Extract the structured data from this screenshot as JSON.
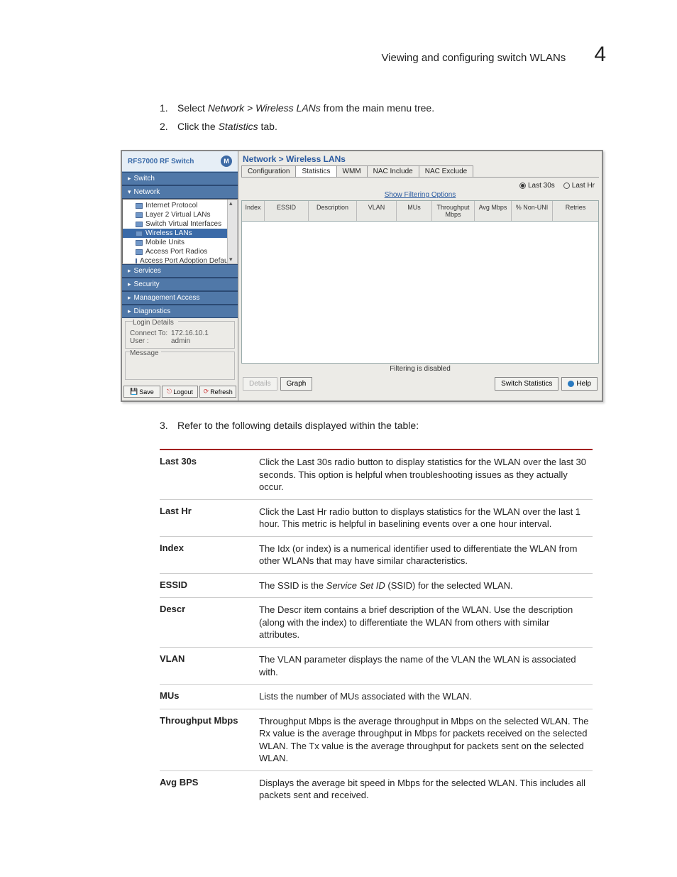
{
  "header": {
    "title": "Viewing and configuring switch WLANs",
    "chapter": "4"
  },
  "steps": {
    "s1_pre": "Select ",
    "s1_em": "Network > Wireless LANs",
    "s1_post": " from the main menu tree.",
    "s2_pre": "Click the ",
    "s2_em": "Statistics",
    "s2_post": " tab.",
    "s3": "Refer to the following details displayed within the table:"
  },
  "shot": {
    "sidebar": {
      "product_a": "RFS7000",
      "product_b": " RF Switch",
      "logo": "M",
      "acc": {
        "switch": "Switch",
        "network": "Network",
        "services": "Services",
        "security": "Security",
        "mgmt": "Management Access",
        "diag": "Diagnostics"
      },
      "tree": {
        "ip": "Internet Protocol",
        "l2": "Layer 2 Virtual LANs",
        "svi": "Switch Virtual Interfaces",
        "wlans": "Wireless LANs",
        "mu": "Mobile Units",
        "apr": "Access Port Radios",
        "apd": "Access Port Adoption Defaults"
      },
      "login": {
        "legend": "Login Details",
        "connect_l": "Connect To:",
        "connect_v": "172.16.10.1",
        "user_l": "User :",
        "user_v": "admin"
      },
      "msg_legend": "Message",
      "btns": {
        "save": "Save",
        "logout": "Logout",
        "refresh": "Refresh"
      }
    },
    "main": {
      "crumb": "Network > Wireless LANs",
      "tabs": {
        "config": "Configuration",
        "stats": "Statistics",
        "wmm": "WMM",
        "nac_in": "NAC Include",
        "nac_ex": "NAC Exclude"
      },
      "radios": {
        "last30": "Last 30s",
        "lasthr": "Last Hr"
      },
      "filter_link": "Show Filtering Options",
      "cols": {
        "index": "Index",
        "essid": "ESSID",
        "desc": "Description",
        "vlan": "VLAN",
        "mus": "MUs",
        "tput": "Throughput Mbps",
        "avg": "Avg Mbps",
        "nonuni": "% Non-UNI",
        "retries": "Retries"
      },
      "filter_status": "Filtering is disabled",
      "btns": {
        "details": "Details",
        "graph": "Graph",
        "switch_stats": "Switch Statistics",
        "help": "Help"
      }
    }
  },
  "defs": {
    "r0": {
      "t": "Last 30s",
      "d": "Click the Last 30s radio button to display statistics for the WLAN over the last 30 seconds. This option is helpful when troubleshooting issues as they actually occur."
    },
    "r1": {
      "t": "Last Hr",
      "d": "Click the Last Hr radio button to displays statistics for the WLAN over the last 1 hour. This metric is helpful in baselining events over a one hour interval."
    },
    "r2": {
      "t": "Index",
      "d": "The Idx (or index) is a numerical identifier used to differentiate the WLAN from other WLANs that may have similar characteristics."
    },
    "r3": {
      "t": "ESSID",
      "d_pre": "The SSID is the ",
      "d_em": "Service Set ID",
      "d_post": " (SSID) for the selected WLAN."
    },
    "r4": {
      "t": "Descr",
      "d": "The Descr item contains a brief description of the WLAN. Use the description (along with the index) to differentiate the WLAN from others with similar attributes."
    },
    "r5": {
      "t": "VLAN",
      "d": "The VLAN parameter displays the name of the VLAN the WLAN is associated with."
    },
    "r6": {
      "t": "MUs",
      "d": "Lists the number of MUs associated with the WLAN."
    },
    "r7": {
      "t": "Throughput Mbps",
      "d": "Throughput Mbps is the average throughput in Mbps on the selected WLAN. The Rx value is the average throughput in Mbps for packets received on the selected WLAN. The Tx value is the average throughput for packets sent on the selected WLAN."
    },
    "r8": {
      "t": "Avg BPS",
      "d": "Displays the average bit speed in Mbps for the selected WLAN. This includes all packets sent and received."
    }
  }
}
